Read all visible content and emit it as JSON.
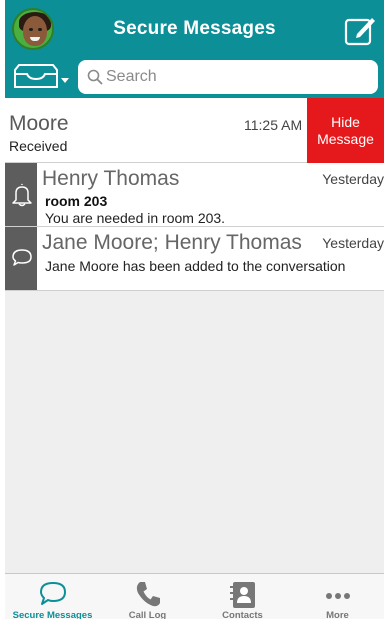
{
  "header": {
    "title": "Secure Messages",
    "avatar": "user-avatar",
    "compose_icon": "compose-icon"
  },
  "search": {
    "placeholder": "Search",
    "filter_icon": "inbox-tray-icon"
  },
  "messages": [
    {
      "name": "Moore",
      "status": "Received",
      "time": "11:25 AM",
      "action_label": "Hide\nMessage",
      "swiped": true
    },
    {
      "name": "Henry Thomas",
      "time": "Yesterday",
      "subject": "room 203",
      "preview": "You are needed in room 203.",
      "type_icon": "bell-icon"
    },
    {
      "name": "Jane Moore; Henry Thomas",
      "time": "Yesterday",
      "preview": "Jane Moore has been added to the conversation",
      "type_icon": "chat-bubble-icon"
    }
  ],
  "tabs": [
    {
      "label": "Secure Messages",
      "icon": "chat-bubble-icon",
      "active": true
    },
    {
      "label": "Call Log",
      "icon": "phone-icon",
      "active": false
    },
    {
      "label": "Contacts",
      "icon": "contacts-book-icon",
      "active": false
    },
    {
      "label": "More",
      "icon": "more-dots-icon",
      "active": false
    }
  ],
  "colors": {
    "brand": "#0d8f98",
    "hide_action": "#e5191b",
    "side_bar": "#5d5d5d"
  }
}
